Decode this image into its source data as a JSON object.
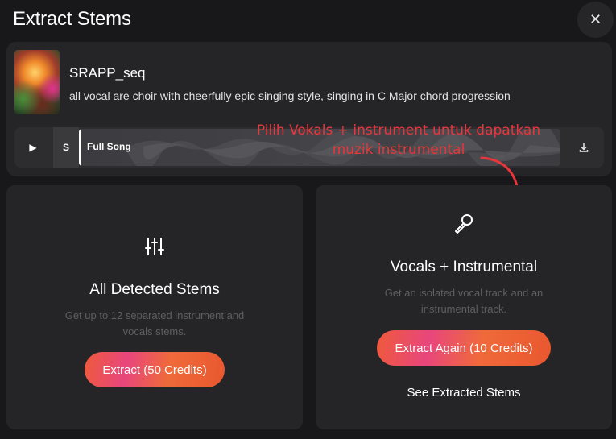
{
  "header": {
    "title": "Extract Stems",
    "close_icon": "close-icon"
  },
  "song": {
    "title": "SRAPP_seq",
    "description": "all vocal are choir with cheerfully epic singing style, singing in C Major chord progression",
    "player": {
      "play_icon": "play-icon",
      "solo_label": "S",
      "track_label": "Full Song",
      "download_icon": "download-icon"
    }
  },
  "annotation": {
    "line1": "Pilih Vokals + instrument untuk dapatkan",
    "line2": "muzik instrumental",
    "color": "#e8363c"
  },
  "options": {
    "all_stems": {
      "icon": "sliders-icon",
      "title": "All Detected Stems",
      "description": "Get up to 12 separated instrument and vocals stems.",
      "button_label": "Extract (50 Credits)"
    },
    "vocals_instrumental": {
      "icon": "microphone-icon",
      "title": "Vocals + Instrumental",
      "description": "Get an isolated vocal track and an instrumental track.",
      "button_label": "Extract Again (10 Credits)",
      "link_label": "See Extracted Stems"
    }
  },
  "colors": {
    "background": "#18181a",
    "card": "#252527",
    "accent_gradient_start": "#ee5a3b",
    "accent_gradient_mid": "#e8467c"
  }
}
